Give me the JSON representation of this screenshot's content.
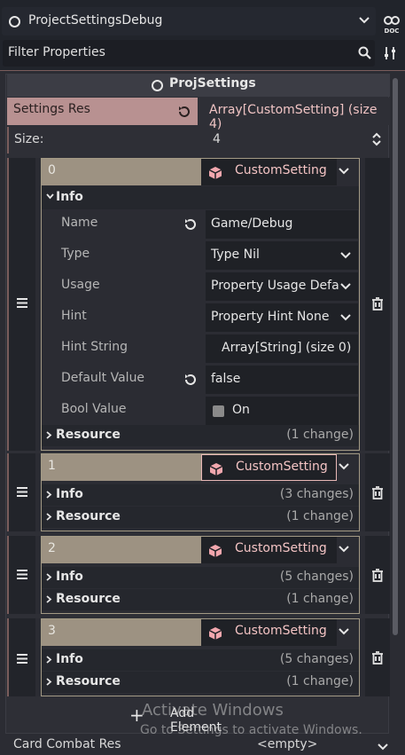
{
  "header": {
    "node_name": "ProjectSettingsDebug",
    "filter_placeholder": "Filter Properties"
  },
  "inspector": {
    "resource_title": "ProjSettings",
    "settings_res": {
      "label": "Settings Res",
      "value": "Array[CustomSetting] (size 4)"
    },
    "size": {
      "label": "Size:",
      "value": "4"
    },
    "elements": [
      {
        "index": "0",
        "type": "CustomSetting",
        "info_label": "Info",
        "properties": [
          {
            "label": "Name",
            "value": "Game/Debug"
          },
          {
            "label": "Type",
            "value": "Type Nil"
          },
          {
            "label": "Usage",
            "value": "Property Usage Defa"
          },
          {
            "label": "Hint",
            "value": "Property Hint None"
          },
          {
            "label": "Hint String",
            "value": "Array[String] (size 0)"
          },
          {
            "label": "Default Value",
            "value": "false"
          },
          {
            "label": "Bool Value",
            "value": "On"
          }
        ],
        "resource_label": "Resource",
        "resource_changes": "(1 change)"
      },
      {
        "index": "1",
        "type": "CustomSetting",
        "info_label": "Info",
        "info_changes": "(3 changes)",
        "resource_label": "Resource",
        "resource_changes": "(1 change)"
      },
      {
        "index": "2",
        "type": "CustomSetting",
        "info_label": "Info",
        "info_changes": "(5 changes)",
        "resource_label": "Resource",
        "resource_changes": "(1 change)"
      },
      {
        "index": "3",
        "type": "CustomSetting",
        "info_label": "Info",
        "info_changes": "(5 changes)",
        "resource_label": "Resource",
        "resource_changes": "(1 change)"
      }
    ],
    "add_element": "Add Element",
    "card_combat_res": {
      "label": "Card Combat Res",
      "value": "<empty>"
    }
  },
  "overlay": {
    "watermark_title": "Activate Windows",
    "watermark_sub": "Go to Settings to activate Windows."
  },
  "colors": {
    "accent_pink": "#b89191",
    "element_header": "#9d9282",
    "resource_text": "#f4c4c4"
  }
}
